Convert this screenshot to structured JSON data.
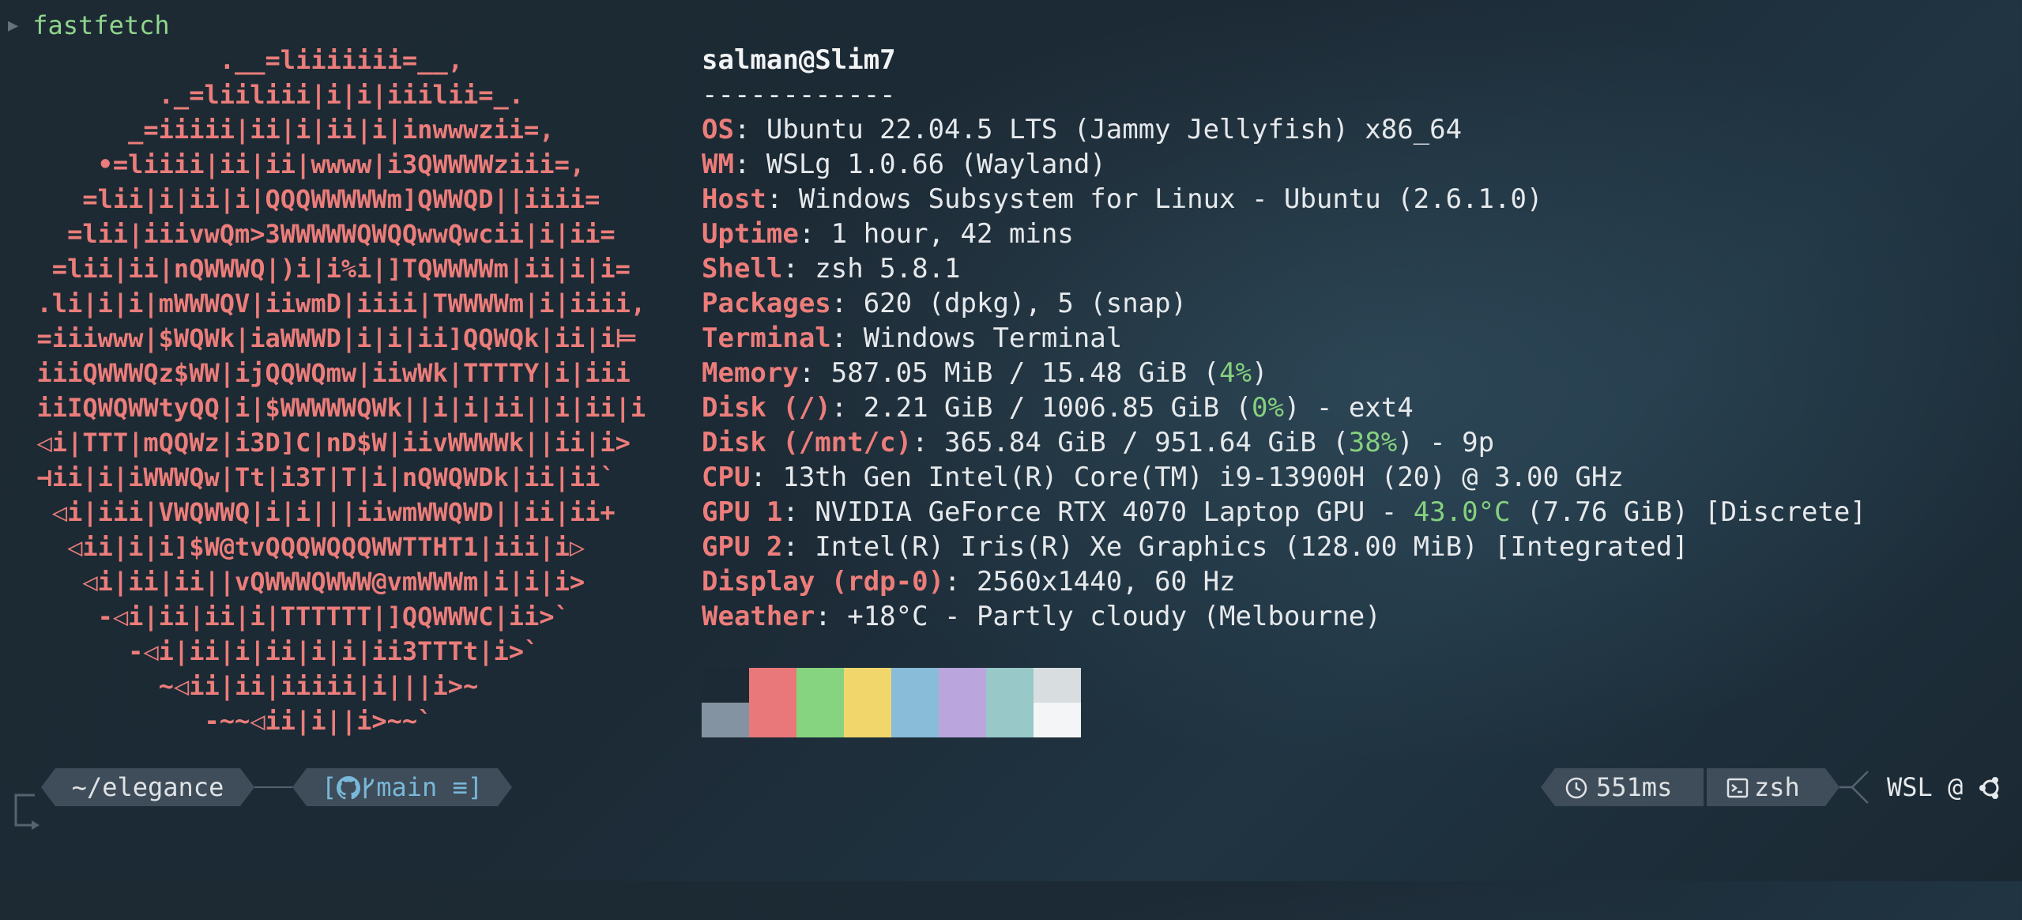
{
  "command": {
    "prompt_icon": "caret-right-icon",
    "text": "fastfetch"
  },
  "logo_lines": [
    "              .__=liiiiiii=__,",
    "          ._=liiliii|i|i|iiilii=_.",
    "        _=iiiii|ii|i|ii|i|inwwwzii=,",
    "      •=liiii|ii|ii|wwww|i3QWWWWziii=,",
    "     =lii|i|ii|i|QQQWWWWWm]QWWQD||iiii=",
    "    =lii|iiivwQm>3WWWWWQWQQwwQwcii|i|ii=",
    "   =lii|ii|nQWWWQ|)i|i%i|]TQWWWWm|ii|i|i=",
    "  .li|i|i|mWWWQV|iiwmD|iiii|TWWWWm|i|iiii,",
    "  =iiiwww|$WQWk|iaWWWD|i|i|ii]QQWQk|ii|i⊨",
    "  iiiQWWWQz$WW|ijQQWQmw|iiwWk|TTTTY|i|iii",
    "  iiIQWQWWtyQQ|i|$WWWWWQWk||i|i|ii||i|ii|i",
    "  ◁i|TTT|mQQWz|i3D]C|nD$W|iivWWWWk||ii|i>",
    "  ⊣ii|i|iWWWQw|Tt|i3T|T|i|nQWQWDk|ii|ii`",
    "   ◁i|iii|VWQWWQ|i|i|||iiwmWWQWD||ii|ii+",
    "    ◁ii|i|i]$W@tvQQQWQQQWWTTHT1|iii|i▷",
    "     ◁i|ii|ii||vQWWWQWWW@vmWWWm|i|i|i>",
    "      -◁i|ii|ii|i|TTTTTT|]QQWWWC|ii>`",
    "        -◁i|ii|i|ii|i|i|ii3TTTt|i>`",
    "          ~◁ii|ii|iiiii|i|||i>~",
    "             -~~◁ii|i||i>~~`"
  ],
  "info": {
    "user": "salman@Slim7",
    "separator": "------------",
    "rows": [
      {
        "key": "OS",
        "value": ": Ubuntu 22.04.5 LTS (Jammy Jellyfish) x86_64"
      },
      {
        "key": "WM",
        "value": ": WSLg 1.0.66 (Wayland)"
      },
      {
        "key": "Host",
        "value": ": Windows Subsystem for Linux - Ubuntu (2.6.1.0)"
      },
      {
        "key": "Uptime",
        "value": ": 1 hour, 42 mins"
      },
      {
        "key": "Shell",
        "value": ": zsh 5.8.1"
      },
      {
        "key": "Packages",
        "value": ": 620 (dpkg), 5 (snap)"
      },
      {
        "key": "Terminal",
        "value": ": Windows Terminal"
      },
      {
        "key": "Memory",
        "value": ": 587.05 MiB / 15.48 GiB (",
        "hl": "4%",
        "after": ")"
      },
      {
        "key": "Disk (/)",
        "value": ": 2.21 GiB / 1006.85 GiB (",
        "hl": "0%",
        "after": ") - ext4"
      },
      {
        "key": "Disk (/mnt/c)",
        "value": ": 365.84 GiB / 951.64 GiB (",
        "hl": "38%",
        "after": ") - 9p"
      },
      {
        "key": "CPU",
        "value": ": 13th Gen Intel(R) Core(TM) i9-13900H (20) @ 3.00 GHz"
      },
      {
        "key": "GPU 1",
        "value": ": NVIDIA GeForce RTX 4070 Laptop GPU - ",
        "hl": "43.0°C",
        "after": " (7.76 GiB) [Discrete]"
      },
      {
        "key": "GPU 2",
        "value": ": Intel(R) Iris(R) Xe Graphics (128.00 MiB) [Integrated]"
      },
      {
        "key": "Display (rdp-0)",
        "value": ": 2560x1440, 60 Hz"
      },
      {
        "key": "Weather",
        "value": ": +18°C - Partly cloudy (Melbourne)"
      }
    ]
  },
  "palette": {
    "top": [
      "#1c2a35",
      "#e8787a",
      "#86d47f",
      "#f0d66b",
      "#88bcd8",
      "#baa6dd",
      "#98c8c8",
      "#d8dde0"
    ],
    "bottom": [
      "#8493a1",
      "#e8787a",
      "#86d47f",
      "#f0d66b",
      "#88bcd8",
      "#baa6dd",
      "#98c8c8",
      "#f4f5f6"
    ]
  },
  "prompt": {
    "path": "~/elegance",
    "git_open": "[",
    "git_icon": "github-icon",
    "branch_icon": "git-branch-icon",
    "branch": "main",
    "git_status": "≡]",
    "time_icon": "clock-icon",
    "duration": "551ms",
    "shell_icon": "terminal-icon",
    "shell": "zsh",
    "host_text": "WSL @",
    "os_icon": "ubuntu-icon"
  }
}
